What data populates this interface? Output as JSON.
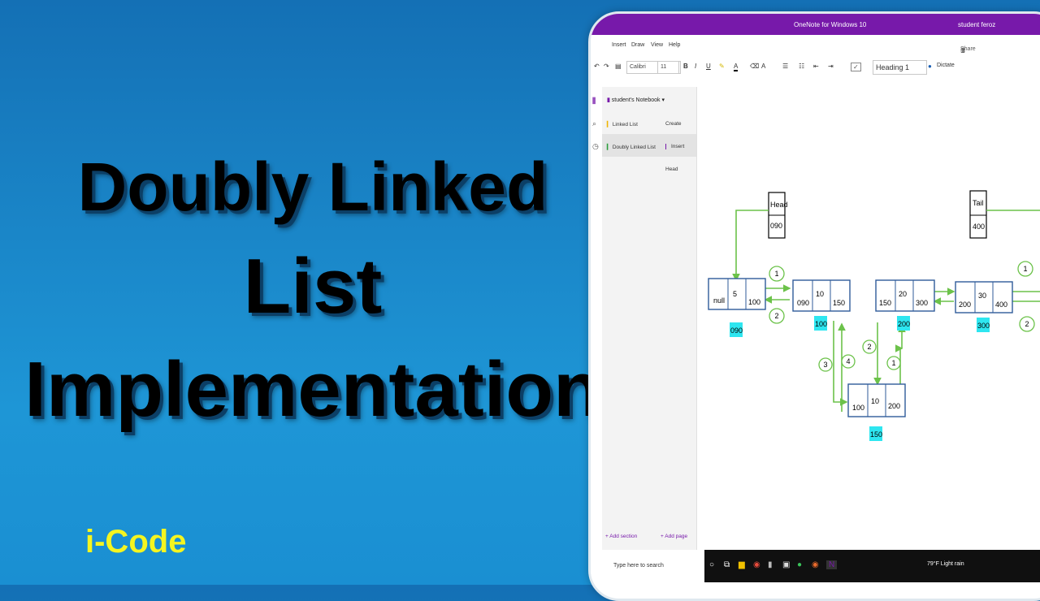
{
  "heading": {
    "line1": "Doubly Linked",
    "line2": "List",
    "line3": "Implementation"
  },
  "brand": "i-Code",
  "app": {
    "title": "OneNote for Windows 10",
    "user": "student feroz",
    "menu": [
      "Insert",
      "Draw",
      "View",
      "Help"
    ],
    "share_label": "Share",
    "font_name": "Calibri",
    "font_size": "11",
    "style": "Heading 1",
    "dictate": "Dictate"
  },
  "sidebar": {
    "notebook": "student's Notebook",
    "sections": [
      "Linked List",
      "Doubly Linked List"
    ],
    "pages": [
      "Create",
      "Insert",
      "Head"
    ],
    "add_section": "Add section",
    "add_page": "Add page"
  },
  "diagram": {
    "head_label": "Head",
    "head_value": "090",
    "tail_label": "Tail",
    "tail_value": "400",
    "nodes": [
      {
        "cells": [
          "null",
          "5",
          "100"
        ],
        "addr": "090"
      },
      {
        "cells": [
          "090",
          "10",
          "150"
        ],
        "addr": "100"
      },
      {
        "cells": [
          "150",
          "20",
          "300"
        ],
        "addr": "200"
      },
      {
        "cells": [
          "200",
          "30",
          "400"
        ],
        "addr": "300"
      },
      {
        "cells": [
          "100",
          "10",
          "200"
        ],
        "addr": "150"
      }
    ],
    "steps": [
      "1",
      "2",
      "3",
      "4",
      "2",
      "1",
      "1",
      "2"
    ]
  },
  "taskbar": {
    "search": "Type here to search",
    "weather": "79°F Light rain"
  },
  "colors": {
    "accent": "#7719aa",
    "arrow": "#6cc24a",
    "highlight": "#2ee6f0",
    "node_border": "#2f5b9a"
  }
}
